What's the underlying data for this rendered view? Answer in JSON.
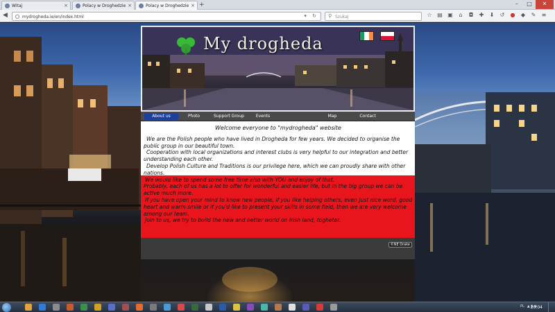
{
  "browser": {
    "tabs": [
      {
        "label": "Witaj",
        "active": false
      },
      {
        "label": "Polacy w Droghedzie",
        "active": false
      },
      {
        "label": "Polacy w Droghedzie",
        "active": true
      }
    ],
    "url": "mydrogheda.ie/en/index.html",
    "search_placeholder": "Szukaj",
    "new_tab_symbol": "+"
  },
  "site": {
    "title": "My drogheda",
    "nav": [
      {
        "label": "About us",
        "active": true
      },
      {
        "label": "Photo",
        "active": false
      },
      {
        "label": "Support Group",
        "active": false
      },
      {
        "label": "Events",
        "active": false
      },
      {
        "label": "Map",
        "active": false
      },
      {
        "label": "Contact",
        "active": false
      }
    ],
    "welcome": "Welcome everyone to \"mydrogheda\" website",
    "paragraphs_white": [
      "We are the Polish people who have lived in Drogheda for few years. We decided to organise the public group in our beautiful town.",
      "Cooperation with local organizations and interest clubs is very helpful to our integration and better understanding each other.",
      "Develop Polish Culture and Traditions is our privilege here, which we can proudly share with other nations."
    ],
    "paragraphs_red": [
      "We would like to spend some free time also with YOU and enjoy of that.",
      "Probably, each of us has a lot to offer for wonderful and easier life, but in the big group we can be active much more.",
      "If you have open your mind to know new people, if you like helping others, even just nice word, good heart and warm smile or if you'd like to present your skills in some field, then we are very welcome among our team.",
      "Join to us, we try to build the new and better world on Irish land, togheter."
    ],
    "copyright": "©NE Drake"
  },
  "taskbar": {
    "language": "PL",
    "clock": "20:04"
  },
  "colors": {
    "nav_active": "#1d3f9e",
    "content_red": "#e8151d",
    "irish_green": "#169b62",
    "irish_orange": "#ff883e",
    "polish_red": "#dc143c"
  }
}
